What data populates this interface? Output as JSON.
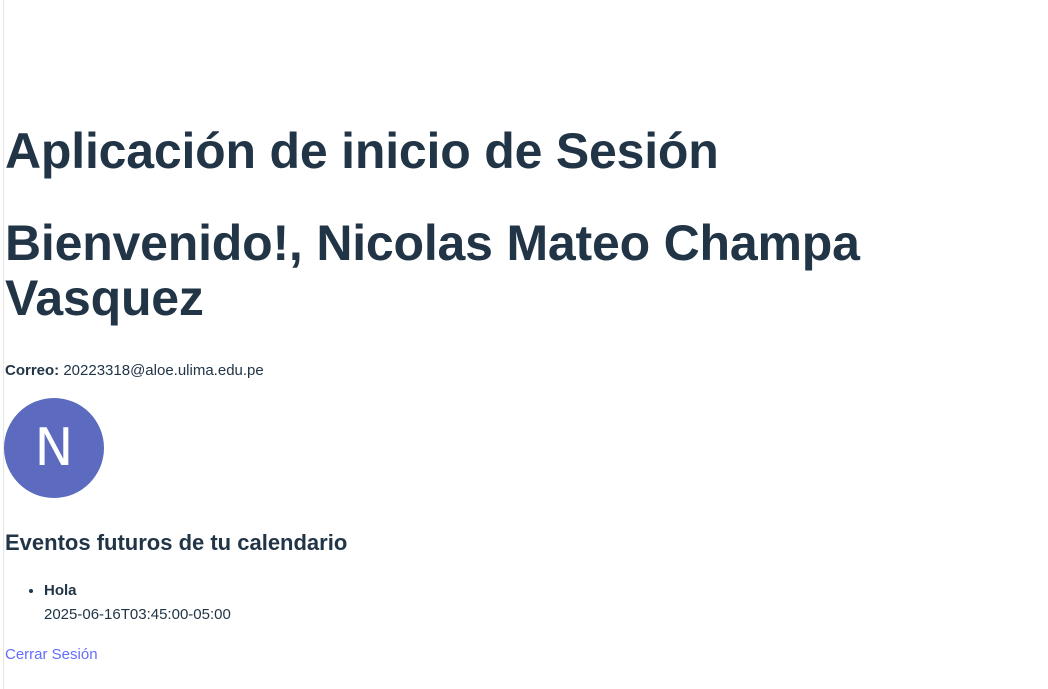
{
  "app": {
    "title": "Aplicación de inicio de Sesión",
    "welcome": "Bienvenido!, Nicolas Mateo Champa Vasquez"
  },
  "user": {
    "email_label": "Correo:",
    "email": "20223318@aloe.ulima.edu.pe",
    "avatar_initial": "N"
  },
  "events": {
    "heading": "Eventos futuros de tu calendario",
    "items": [
      {
        "title": "Hola",
        "datetime": "2025-06-16T03:45:00-05:00"
      }
    ]
  },
  "actions": {
    "logout_label": "Cerrar Sesión"
  },
  "colors": {
    "text": "#213547",
    "avatar_bg": "#5c6bc0",
    "link": "#646cff"
  }
}
